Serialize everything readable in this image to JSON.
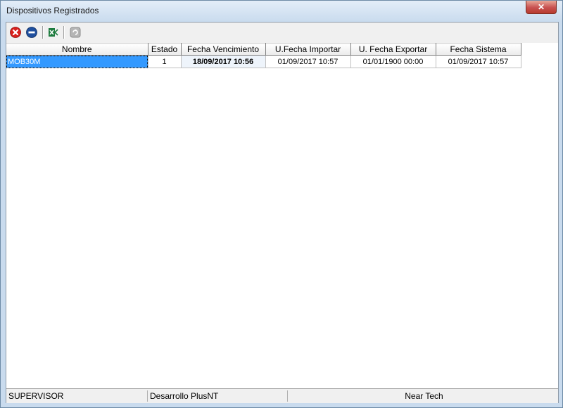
{
  "window": {
    "title": "Dispositivos Registrados",
    "close_glyph": "✕"
  },
  "toolbar": {
    "buttons": [
      {
        "name": "delete-icon",
        "color": "#d9201c"
      },
      {
        "name": "disable-icon",
        "color": "#1f4f9e"
      },
      {
        "name": "excel-export-icon",
        "color": "#1d7b3e"
      },
      {
        "name": "refresh-icon",
        "color": "#9a9a9a"
      }
    ]
  },
  "grid": {
    "columns": [
      "Nombre",
      "Estado",
      "Fecha Vencimiento",
      "U.Fecha Importar",
      "U. Fecha Exportar",
      "Fecha Sistema"
    ],
    "rows": [
      [
        "MOB30M",
        "1",
        "18/09/2017 10:56",
        "01/09/2017 10:57",
        "01/01/1900 00:00",
        "01/09/2017 10:57"
      ]
    ]
  },
  "statusbar": {
    "user": "SUPERVISOR",
    "company": "Desarrollo PlusNT",
    "vendor": "Near Tech"
  }
}
